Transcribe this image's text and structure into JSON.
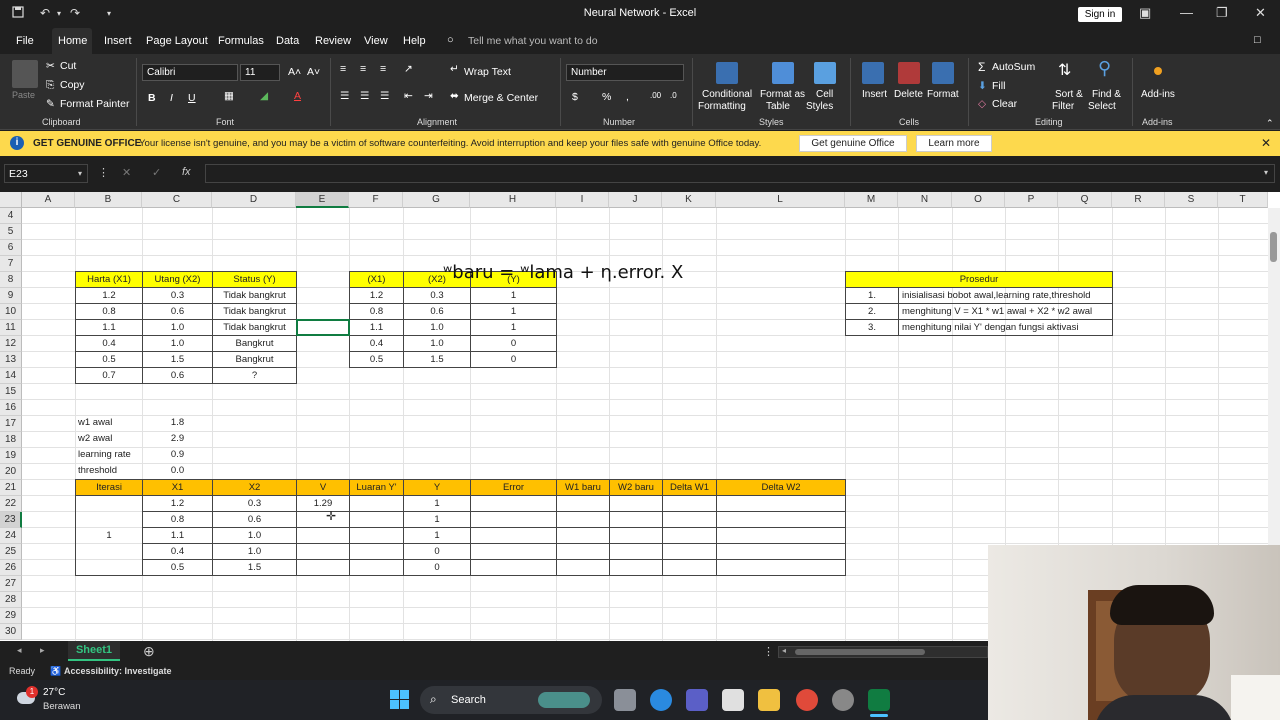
{
  "window": {
    "title": "Neural Network - Excel",
    "signin": "Sign in"
  },
  "menu": [
    "File",
    "Home",
    "Insert",
    "Page Layout",
    "Formulas",
    "Data",
    "Review",
    "View",
    "Help"
  ],
  "tellme": "Tell me what you want to do",
  "ribbon": {
    "cut": "Cut",
    "copy": "Copy",
    "format_painter": "Format Painter",
    "paste": "Paste",
    "font_name": "Calibri",
    "font_size": "11",
    "wrap_text": "Wrap Text",
    "merge_center": "Merge & Center",
    "number_format": "Number",
    "conditional_formatting": [
      "Conditional",
      "Formatting"
    ],
    "format_as_table": [
      "Format as",
      "Table"
    ],
    "cell_styles": [
      "Cell",
      "Styles"
    ],
    "insert": "Insert",
    "delete": "Delete",
    "format": "Format",
    "autosum": "AutoSum",
    "fill": "Fill",
    "clear": "Clear",
    "sort_filter": [
      "Sort &",
      "Filter"
    ],
    "find_select": [
      "Find &",
      "Select"
    ],
    "addins": "Add-ins",
    "groups": [
      "Clipboard",
      "Font",
      "Alignment",
      "Number",
      "Styles",
      "Cells",
      "Editing",
      "Add-ins"
    ]
  },
  "license": {
    "heading": "GET GENUINE OFFICE",
    "message": "Your license isn't genuine, and you may be a victim of software counterfeiting. Avoid interruption and keep your files safe with genuine Office today.",
    "btn_genuine": "Get genuine Office",
    "btn_learn": "Learn more"
  },
  "namebox": "E23",
  "columns": [
    "A",
    "B",
    "C",
    "D",
    "E",
    "F",
    "G",
    "H",
    "I",
    "J",
    "K",
    "L",
    "M",
    "N",
    "O",
    "P",
    "Q",
    "R",
    "S",
    "T"
  ],
  "rows": [
    "4",
    "5",
    "6",
    "7",
    "8",
    "9",
    "10",
    "11",
    "12",
    "13",
    "14",
    "15",
    "16",
    "17",
    "18",
    "19",
    "20",
    "21",
    "22",
    "23",
    "24",
    "25",
    "26",
    "27",
    "28",
    "29",
    "30"
  ],
  "table1": {
    "headers": [
      "Harta (X1)",
      "Utang (X2)",
      "Status (Y)"
    ],
    "rows": [
      [
        "1.2",
        "0.3",
        "Tidak bangkrut"
      ],
      [
        "0.8",
        "0.6",
        "Tidak bangkrut"
      ],
      [
        "1.1",
        "1.0",
        "Tidak bangkrut"
      ],
      [
        "0.4",
        "1.0",
        "Bangkrut"
      ],
      [
        "0.5",
        "1.5",
        "Bangkrut"
      ],
      [
        "0.7",
        "0.6",
        "?"
      ]
    ]
  },
  "table2": {
    "headers": [
      "(X1)",
      "(X2)",
      "(Y)"
    ],
    "rows": [
      [
        "1.2",
        "0.3",
        "1"
      ],
      [
        "0.8",
        "0.6",
        "1"
      ],
      [
        "1.1",
        "1.0",
        "1"
      ],
      [
        "0.4",
        "1.0",
        "0"
      ],
      [
        "0.5",
        "1.5",
        "0"
      ]
    ]
  },
  "prosedur": {
    "header": "Prosedur",
    "items": [
      [
        "1.",
        "inisialisasi bobot awal,learning rate,threshold"
      ],
      [
        "2.",
        "menghitung V = X1 * w1 awal + X2 * w2 awal"
      ],
      [
        "3.",
        "menghitung nilai Y' dengan fungsi aktivasi"
      ]
    ]
  },
  "params": [
    [
      "w1 awal",
      "1.8"
    ],
    [
      "w2 awal",
      "2.9"
    ],
    [
      "learning rate",
      "0.9"
    ],
    [
      "threshold",
      "0.0"
    ]
  ],
  "formula_text": "ʷbaru = ʷlama + η.error. X",
  "iter": {
    "headers": [
      "Iterasi",
      "X1",
      "X2",
      "V",
      "Luaran Y'",
      "Y",
      "Error",
      "W1 baru",
      "W2 baru",
      "Delta W1",
      "Delta W2"
    ],
    "iter_label": "1",
    "rows": [
      [
        "1.2",
        "0.3",
        "1.29",
        "",
        "1"
      ],
      [
        "0.8",
        "0.6",
        "",
        "",
        "1"
      ],
      [
        "1.1",
        "1.0",
        "",
        "",
        "1"
      ],
      [
        "0.4",
        "1.0",
        "",
        "",
        "0"
      ],
      [
        "0.5",
        "1.5",
        "",
        "",
        "0"
      ]
    ]
  },
  "sheet_tab": "Sheet1",
  "status": {
    "ready": "Ready",
    "accessibility": "Accessibility: Investigate"
  },
  "taskbar": {
    "temp": "27°C",
    "weather": "Berawan",
    "search": "Search",
    "badge": "1"
  }
}
